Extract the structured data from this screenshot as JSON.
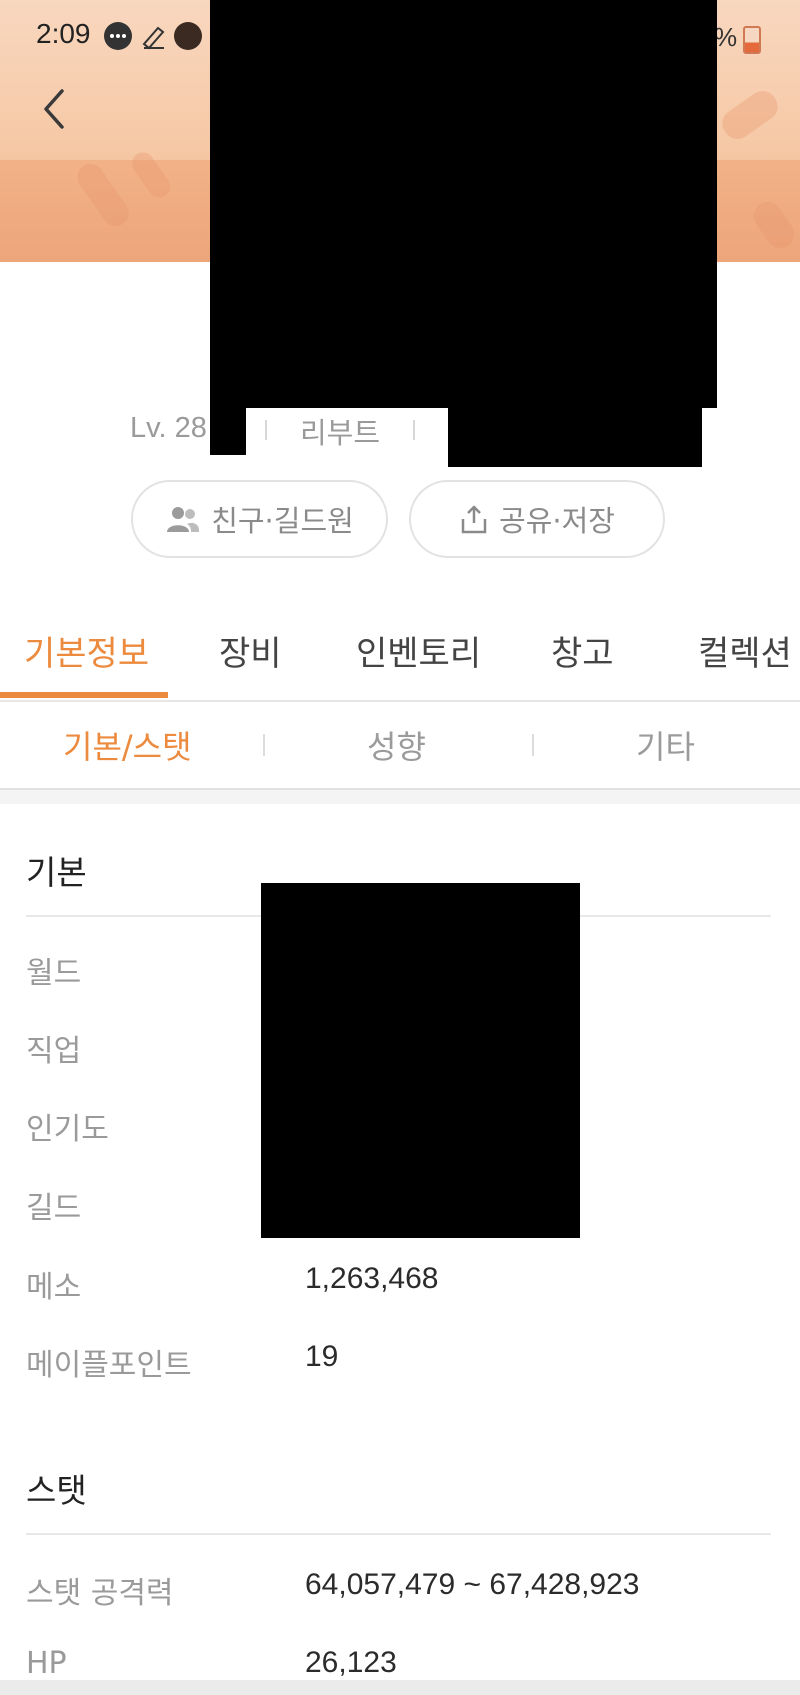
{
  "status_bar": {
    "time": "2:09",
    "battery_text": "%"
  },
  "profile": {
    "level": "Lv. 28",
    "server": "리부트"
  },
  "actions": {
    "friends_label": "친구·길드원",
    "share_label": "공유·저장"
  },
  "tabs": [
    {
      "label": "기본정보",
      "active": true
    },
    {
      "label": "장비",
      "active": false
    },
    {
      "label": "인벤토리",
      "active": false
    },
    {
      "label": "창고",
      "active": false
    },
    {
      "label": "컬렉션",
      "active": false
    }
  ],
  "subtabs": [
    {
      "label": "기본/스탯",
      "active": true
    },
    {
      "label": "성향",
      "active": false
    },
    {
      "label": "기타",
      "active": false
    }
  ],
  "basic": {
    "title": "기본",
    "rows": [
      {
        "label": "월드",
        "value": ""
      },
      {
        "label": "직업",
        "value": ""
      },
      {
        "label": "인기도",
        "value": ""
      },
      {
        "label": "길드",
        "value": ""
      },
      {
        "label": "메소",
        "value": "1,263,468"
      },
      {
        "label": "메이플포인트",
        "value": "19"
      }
    ]
  },
  "stats": {
    "title": "스탯",
    "rows": [
      {
        "label": "스탯 공격력",
        "value": "64,057,479 ~ 67,428,923"
      },
      {
        "label": "HP",
        "value": "26,123"
      }
    ]
  },
  "colors": {
    "accent": "#ec8a3e",
    "banner": "#f6c9a6"
  },
  "icons": {
    "back": "chevron-left-icon",
    "friends": "people-icon",
    "share": "share-icon"
  }
}
